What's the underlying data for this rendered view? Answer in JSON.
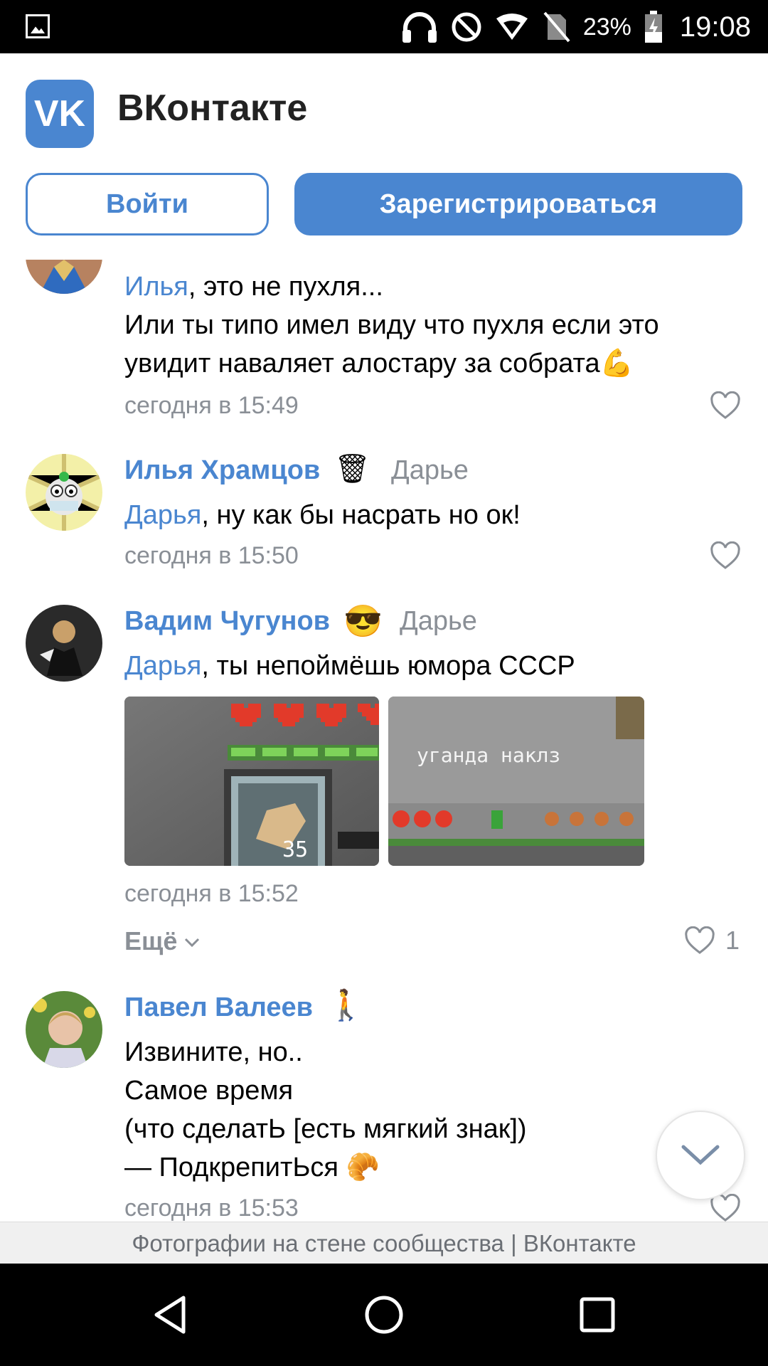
{
  "status_bar": {
    "battery": "23%",
    "time": "19:08"
  },
  "header": {
    "app_title": "ВКонтакте",
    "logo_text": "VK",
    "login_label": "Войти",
    "register_label": "Зарегистрироваться"
  },
  "comments": [
    {
      "mention": "Илья",
      "line1_rest": ", это не пухля...",
      "line2": "Или ты типо имел виду что пухля если это",
      "line3": "увидит наваляет алостару за собрата",
      "time": "сегодня в 15:49"
    },
    {
      "author": "Илья Храмцов",
      "reply_to": "Дарье",
      "mention": "Дарья",
      "text_rest": ", ну как бы насрать но ок!",
      "time": "сегодня в 15:50"
    },
    {
      "author": "Вадим Чугунов",
      "reply_to": "Дарье",
      "mention": "Дарья",
      "text_rest": ", ты непоймёшь юмора СССР",
      "photo1_count": "35",
      "photo2_caption": "уганда наклз",
      "time": "сегодня в 15:52",
      "more_label": "Ещё",
      "likes": "1"
    },
    {
      "author": "Павел Валеев",
      "line1": "Извините, но..",
      "line2": "Самое время",
      "line3": "(что сделатЬ [есть мягкий знак])",
      "line4": "— ПодкрепитЬся 🥐",
      "time": "сегодня в 15:53"
    }
  ],
  "footer": {
    "text": "Фотографии на стене сообщества | ВКонтакте"
  },
  "icons": {
    "status": [
      "gallery-icon",
      "headphones-icon",
      "do-not-disturb-icon",
      "wifi-icon",
      "no-sim-icon",
      "battery-charging-icon"
    ],
    "nav": [
      "back-icon",
      "home-icon",
      "recents-icon"
    ]
  },
  "colors": {
    "accent": "#4a86d0",
    "muted": "#8a8f96"
  }
}
